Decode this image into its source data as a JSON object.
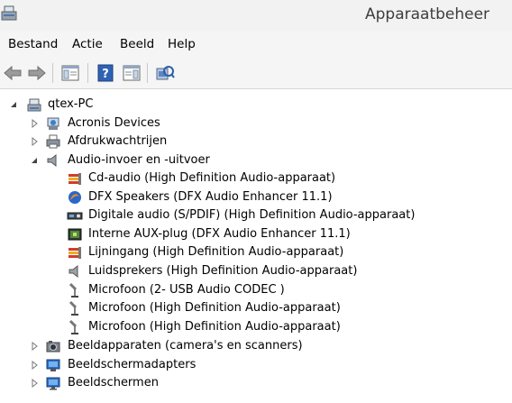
{
  "window": {
    "title": "Apparaatbeheer"
  },
  "menu": {
    "items": [
      "Bestand",
      "Actie",
      "Beeld",
      "Help"
    ]
  },
  "tree": {
    "root": {
      "label": "qtex-PC",
      "expanded": true
    },
    "categories_top": [
      {
        "label": "Acronis Devices",
        "icon": "acronis-device-icon"
      },
      {
        "label": "Afdrukwachtrijen",
        "icon": "printer-icon"
      }
    ],
    "audio": {
      "label": "Audio-invoer en -uitvoer",
      "icon": "speaker-icon",
      "expanded": true,
      "devices": [
        {
          "label": "Cd-audio (High Definition Audio-apparaat)",
          "icon": "audio-jack-icon"
        },
        {
          "label": "DFX Speakers (DFX Audio Enhancer 11.1)",
          "icon": "dfx-logo-icon"
        },
        {
          "label": "Digitale audio (S/PDIF) (High Definition Audio-apparaat)",
          "icon": "digital-audio-icon"
        },
        {
          "label": "Interne AUX-plug (DFX Audio Enhancer 11.1)",
          "icon": "aux-plug-icon"
        },
        {
          "label": "Lijningang (High Definition Audio-apparaat)",
          "icon": "audio-jack-icon"
        },
        {
          "label": "Luidsprekers (High Definition Audio-apparaat)",
          "icon": "speaker-icon"
        },
        {
          "label": "Microfoon (2- USB Audio CODEC )",
          "icon": "microphone-icon"
        },
        {
          "label": "Microfoon (High Definition Audio-apparaat)",
          "icon": "microphone-icon"
        },
        {
          "label": "Microfoon (High Definition Audio-apparaat)",
          "icon": "microphone-icon"
        }
      ]
    },
    "categories_bottom": [
      {
        "label": "Beeldapparaten (camera's en scanners)",
        "icon": "camera-icon"
      },
      {
        "label": "Beeldschermadapters",
        "icon": "display-adapter-icon"
      },
      {
        "label": "Beeldschermen",
        "icon": "monitor-icon"
      }
    ]
  }
}
